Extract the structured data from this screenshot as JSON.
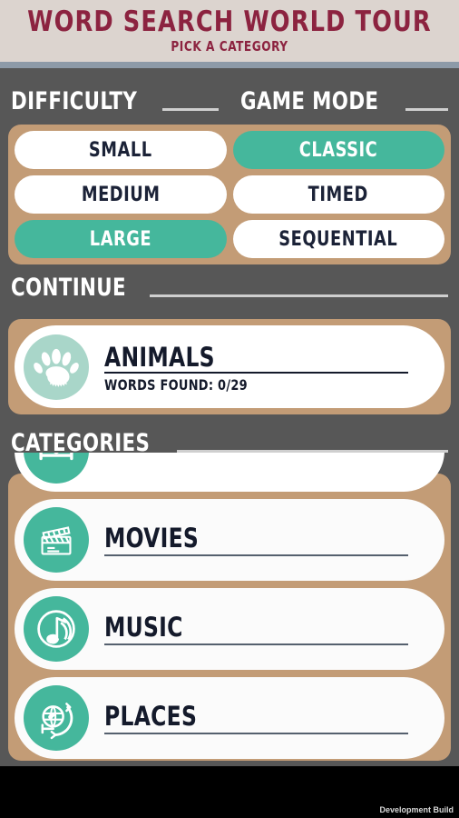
{
  "header": {
    "title": "WORD SEARCH WORLD TOUR",
    "subtitle": "PICK A CATEGORY"
  },
  "difficulty": {
    "heading": "DIFFICULTY",
    "options": [
      {
        "label": "SMALL",
        "selected": false
      },
      {
        "label": "MEDIUM",
        "selected": false
      },
      {
        "label": "LARGE",
        "selected": true
      }
    ]
  },
  "game_mode": {
    "heading": "GAME MODE",
    "options": [
      {
        "label": "CLASSIC",
        "selected": true
      },
      {
        "label": "TIMED",
        "selected": false
      },
      {
        "label": "SEQUENTIAL",
        "selected": false
      }
    ]
  },
  "continue": {
    "heading": "CONTINUE",
    "card": {
      "title": "ANIMALS",
      "progress": "WORDS FOUND: 0/29",
      "icon": "paw-icon"
    }
  },
  "categories": {
    "heading": "CATEGORIES",
    "items": [
      {
        "label": "",
        "icon": "sports-icon",
        "clipped": true
      },
      {
        "label": "MOVIES",
        "icon": "clapperboard-icon",
        "clipped": false
      },
      {
        "label": "MUSIC",
        "icon": "music-note-icon",
        "clipped": false
      },
      {
        "label": "PLACES",
        "icon": "globe-compass-icon",
        "clipped": false
      }
    ]
  },
  "footer": {
    "watermark": "Development Build"
  },
  "colors": {
    "accent_teal": "#45b79c",
    "muted_teal": "#a9d6c9",
    "panel_tan": "#c39c76",
    "background_gray": "#575757",
    "header_bg": "#dcd4cf",
    "header_text": "#8c2340",
    "separator": "#8d9aa8",
    "card_text": "#141a2b",
    "footer_bg": "#000000"
  }
}
